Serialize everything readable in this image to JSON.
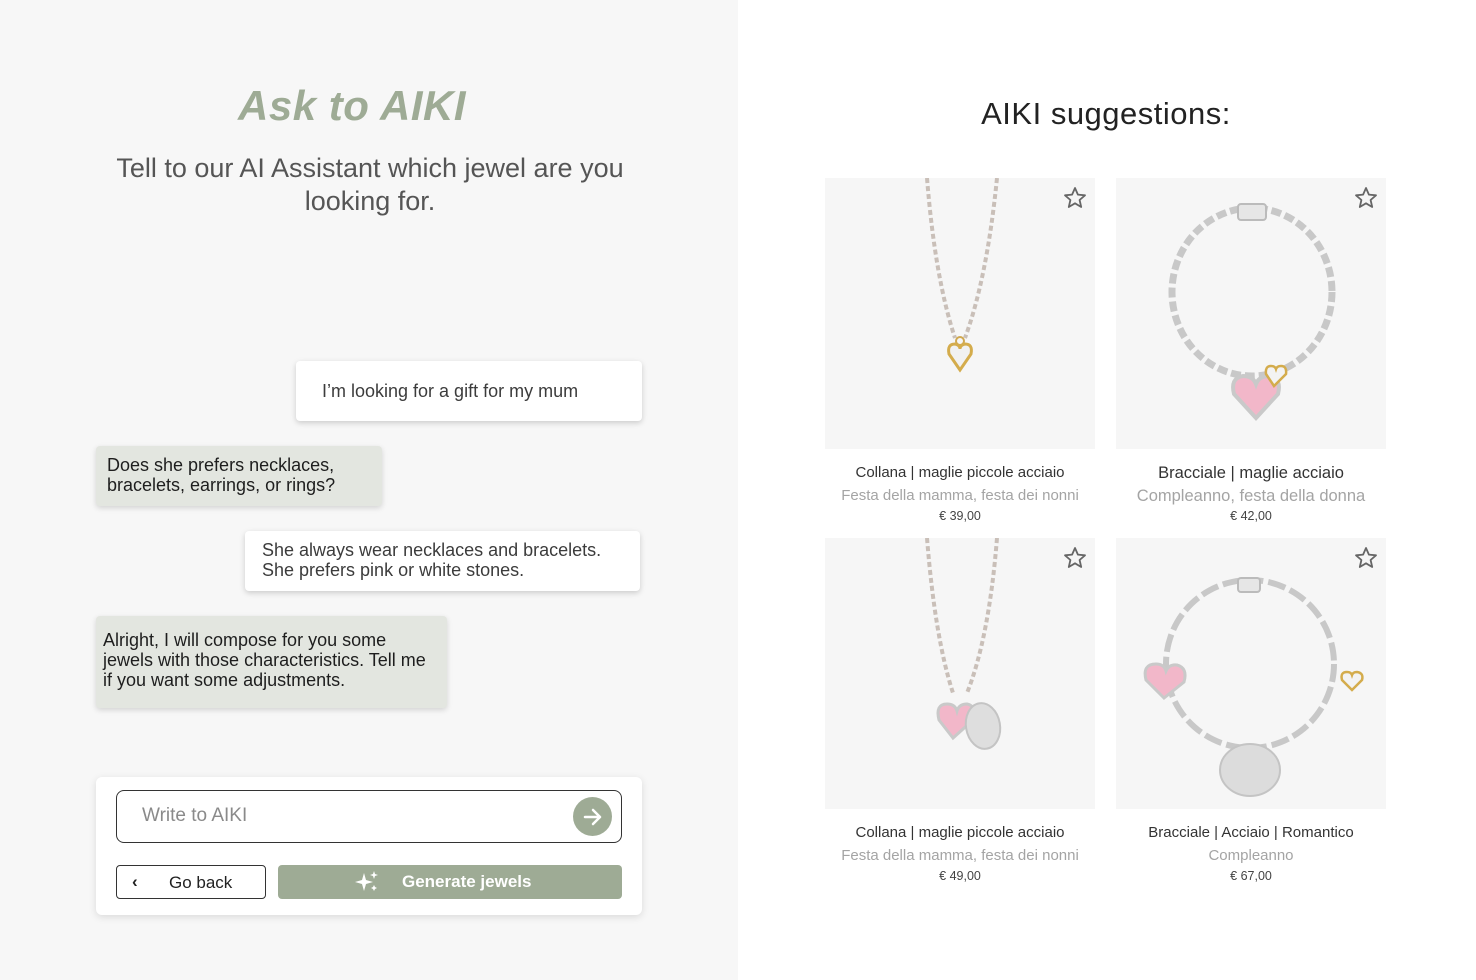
{
  "chat": {
    "title": "Ask to AIKI",
    "subtitle": "Tell to our AI Assistant which jewel are you looking for.",
    "messages": [
      {
        "role": "user",
        "text": "I’m looking for a gift for my mum"
      },
      {
        "role": "ai",
        "text": "Does she prefers necklaces, bracelets, earrings, or rings?"
      },
      {
        "role": "user",
        "text": "She always wear necklaces and bracelets. She prefers pink or white stones."
      },
      {
        "role": "ai",
        "text": "Alright, I will compose for you some jewels with those characteristics. Tell me if you want some adjustments."
      }
    ],
    "input": {
      "placeholder": "Write to AIKI",
      "value": ""
    },
    "back_label": "Go back",
    "generate_label": "Generate jewels"
  },
  "suggestions": {
    "title": "AIKI suggestions:",
    "products": [
      {
        "name": "Collana | maglie piccole acciaio",
        "occasion": "Festa della mamma, festa dei nonni",
        "price": "€ 39,00",
        "image": "necklace-gold-heart"
      },
      {
        "name": "Bracciale | maglie acciaio",
        "occasion": "Compleanno, festa della donna",
        "price": "€ 42,00",
        "image": "bracelet-pink-heart"
      },
      {
        "name": "Collana | maglie piccole acciaio",
        "occasion": "Festa della mamma, festa dei nonni",
        "price": "€ 49,00",
        "image": "necklace-pink-heart-tag"
      },
      {
        "name": "Bracciale | Acciaio | Romantico",
        "occasion": "Compleanno",
        "price": "€ 67,00",
        "image": "bracelet-link-charms"
      }
    ]
  },
  "colors": {
    "accent": "#9eab95",
    "ai_bubble": "#e3e6e0",
    "left_bg": "#f7f7f7"
  }
}
